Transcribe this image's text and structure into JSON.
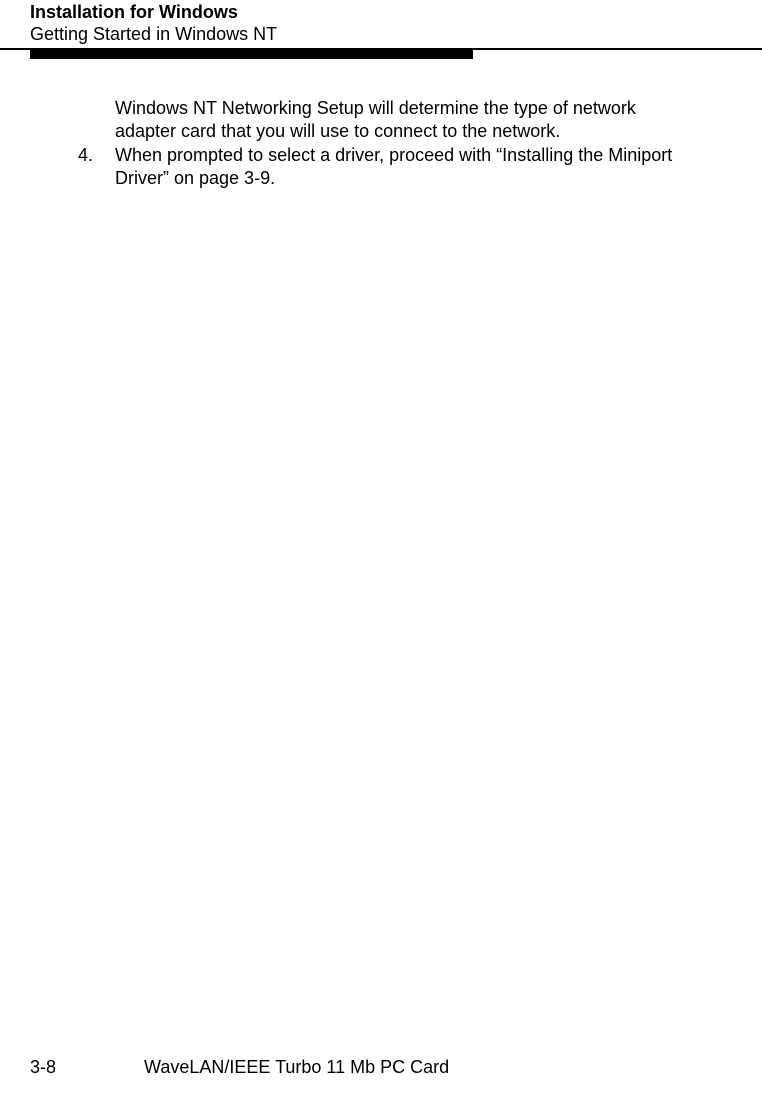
{
  "header": {
    "title": "Installation for Windows",
    "subtitle": "Getting Started in Windows NT"
  },
  "content": {
    "para1": "Windows NT Networking Setup will determine the type of network adapter card that you will use to connect to the network.",
    "listNumber": "4.",
    "listText": "When prompted to select a driver, proceed with “Installing the Miniport Driver” on page 3-9."
  },
  "footer": {
    "pageNumber": "3-8",
    "docTitle": "WaveLAN/IEEE Turbo 11 Mb PC Card"
  }
}
